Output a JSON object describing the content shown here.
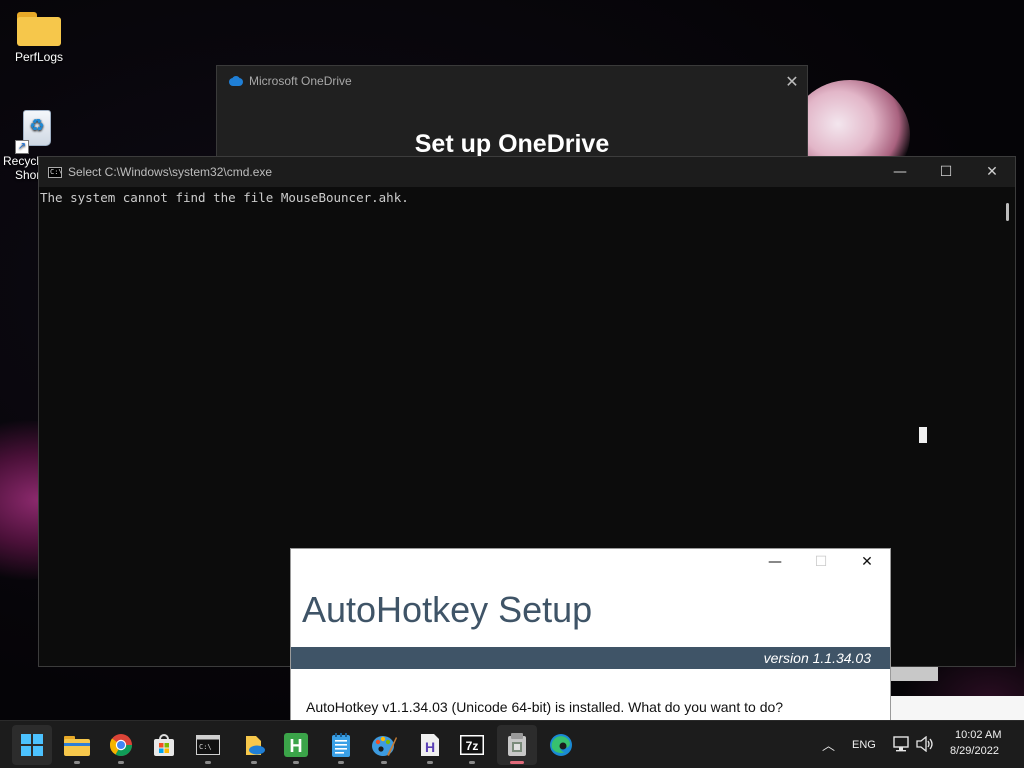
{
  "desktop": {
    "icons": [
      {
        "label": "PerfLogs",
        "icon": "folder-icon"
      },
      {
        "label": "Recycle\nShort",
        "label_line1": "Recycl",
        "label_line2": "Shor",
        "icon": "recycle-bin-icon"
      }
    ]
  },
  "onedrive": {
    "title": "Microsoft OneDrive",
    "heading": "Set up OneDrive",
    "close_glyph": "✕"
  },
  "cmd": {
    "title": "Select C:\\Windows\\system32\\cmd.exe",
    "icon_text": "C:\\",
    "output": "The system cannot find the file MouseBouncer.ahk.",
    "minimize_glyph": "—",
    "maximize_glyph": "☐",
    "close_glyph": "✕"
  },
  "ahk_setup": {
    "title": "AutoHotkey Setup",
    "version": "version 1.1.34.03",
    "message": "AutoHotkey v1.1.34.03 (Unicode 64-bit) is installed. What do you want to do?",
    "minimize_glyph": "—",
    "maximize_glyph": "☐",
    "close_glyph": "✕"
  },
  "taskbar": {
    "apps": [
      {
        "name": "start-button",
        "icon": "windows-logo-icon"
      },
      {
        "name": "file-explorer",
        "icon": "folder-icon"
      },
      {
        "name": "chrome",
        "icon": "chrome-icon"
      },
      {
        "name": "microsoft-store",
        "icon": "store-icon"
      },
      {
        "name": "command-prompt",
        "icon": "terminal-icon"
      },
      {
        "name": "onedrive-folder",
        "icon": "onedrive-folder-icon"
      },
      {
        "name": "h-app",
        "icon": "h-green-icon",
        "glyph": "H"
      },
      {
        "name": "notepad",
        "icon": "notepad-icon"
      },
      {
        "name": "paint",
        "icon": "palette-icon"
      },
      {
        "name": "h-document-app",
        "icon": "h-document-icon",
        "glyph": "H"
      },
      {
        "name": "7zip",
        "icon": "7zip-icon",
        "glyph": "7z"
      },
      {
        "name": "autohotkey-installer",
        "icon": "installer-icon"
      },
      {
        "name": "edge",
        "icon": "edge-icon"
      }
    ],
    "tray": {
      "chevron": "︿",
      "language": "ENG",
      "time": "10:02 AM",
      "date": "8/29/2022"
    }
  }
}
